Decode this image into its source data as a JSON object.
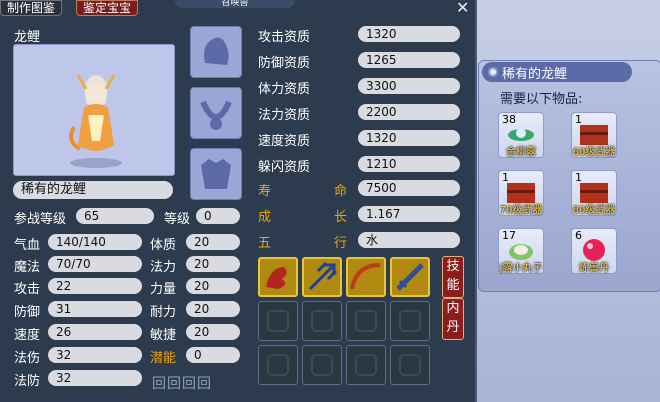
{
  "window": {
    "tab_make": "制作图鉴",
    "tab_appraise": "鉴定宝宝",
    "title": "召唤兽"
  },
  "pet": {
    "name_heading": "龙鲤",
    "name_box": "稀有的龙鲤"
  },
  "attrs": [
    {
      "label": "攻击资质",
      "value": "1320"
    },
    {
      "label": "防御资质",
      "value": "1265"
    },
    {
      "label": "体力资质",
      "value": "3300"
    },
    {
      "label": "法力资质",
      "value": "2200"
    },
    {
      "label": "速度资质",
      "value": "1320"
    },
    {
      "label": "躲闪资质",
      "value": "1210"
    }
  ],
  "special": [
    {
      "label_a": "寿",
      "label_b": "命",
      "value": "7500"
    },
    {
      "label_a": "成",
      "label_b": "长",
      "value": "1.167"
    },
    {
      "label_a": "五",
      "label_b": "行",
      "value": "水"
    }
  ],
  "level": {
    "battle_label": "参战等级",
    "battle_value": "65",
    "level_label": "等级",
    "level_value": "0"
  },
  "left_stats": [
    {
      "label": "气血",
      "value": "140/140"
    },
    {
      "label": "魔法",
      "value": "70/70"
    },
    {
      "label": "攻击",
      "value": "22"
    },
    {
      "label": "防御",
      "value": "31"
    },
    {
      "label": "速度",
      "value": "26"
    },
    {
      "label": "法伤",
      "value": "32"
    },
    {
      "label": "法防",
      "value": "32"
    }
  ],
  "right_stats": [
    {
      "label": "体质",
      "value": "20"
    },
    {
      "label": "法力",
      "value": "20"
    },
    {
      "label": "力量",
      "value": "20"
    },
    {
      "label": "耐力",
      "value": "20"
    },
    {
      "label": "敏捷",
      "value": "20"
    },
    {
      "label": "潜能",
      "value": "0"
    }
  ],
  "side_buttons": {
    "skill": "技能",
    "pill": "内丹"
  },
  "materials": {
    "title": "稀有的龙鲤",
    "need": "需要以下物品:",
    "items": [
      {
        "count": "38",
        "name": "金柳露",
        "icon": "flower-icon"
      },
      {
        "count": "1",
        "name": "60级武器",
        "icon": "chest-icon"
      },
      {
        "count": "1",
        "name": "70级武器",
        "icon": "chest-icon"
      },
      {
        "count": "1",
        "name": "80级武器",
        "icon": "chest-icon"
      },
      {
        "count": "17",
        "name": "J露小丸子",
        "icon": "dumpling-icon"
      },
      {
        "count": "6",
        "name": "炼兽丹",
        "icon": "orb-icon"
      }
    ]
  },
  "colors": {
    "gold_label": "#f0a400",
    "value_box": "#d9dbe0",
    "panel": "#2d3b4e"
  }
}
